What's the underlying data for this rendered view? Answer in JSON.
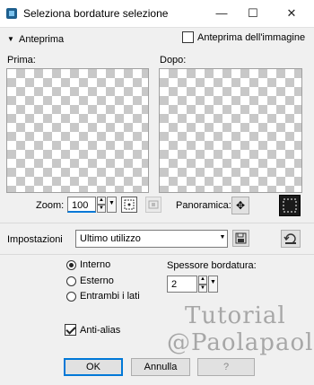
{
  "window": {
    "title": "Seleziona bordature selezione",
    "minimize_glyph": "—",
    "maximize_glyph": "☐",
    "close_glyph": "✕"
  },
  "preview_section": {
    "toggle_label": "Anteprima",
    "image_preview_label": "Anteprima dell'immagine",
    "image_preview_checked": false,
    "before_label": "Prima:",
    "after_label": "Dopo:"
  },
  "zoom": {
    "label": "Zoom:",
    "value": "100"
  },
  "panoramica": {
    "label": "Panoramica:",
    "move_glyph": "✥"
  },
  "settings": {
    "label": "Impostazioni",
    "selected": "Ultimo utilizzo"
  },
  "options": {
    "radios": [
      {
        "label": "Interno",
        "checked": true
      },
      {
        "label": "Esterno",
        "checked": false
      },
      {
        "label": "Entrambi i lati",
        "checked": false
      }
    ],
    "thickness_label": "Spessore bordatura:",
    "thickness_value": "2",
    "antialias_label": "Anti-alias",
    "antialias_checked": true
  },
  "buttons": {
    "ok": "OK",
    "cancel": "Annulla"
  },
  "watermark": {
    "line1": "Tutorial",
    "line2": "@Paolapaola"
  }
}
